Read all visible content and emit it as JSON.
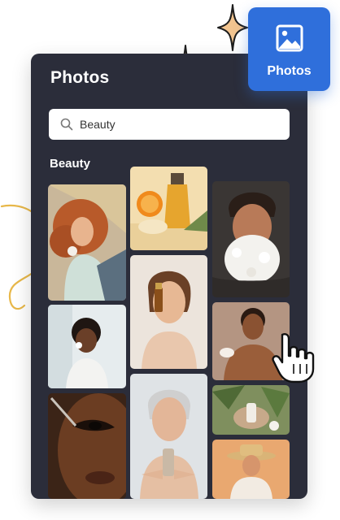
{
  "panel": {
    "title": "Photos"
  },
  "search": {
    "value": "Beauty",
    "icon": "search-icon"
  },
  "section": {
    "label": "Beauty"
  },
  "badge": {
    "label": "Photos",
    "icon": "image-icon"
  },
  "colors": {
    "panel": "#2b2d3a",
    "badge": "#2f6fdb",
    "sparkle": "#f2c48f",
    "doodle": "#e8b84a"
  },
  "photos": [
    {
      "id": "woman-curly-red-hair-flowers"
    },
    {
      "id": "woman-applying-cream-smiling"
    },
    {
      "id": "eye-closeup-dropper"
    },
    {
      "id": "oil-bottles-orange"
    },
    {
      "id": "woman-holding-serum-bottle"
    },
    {
      "id": "older-woman-holding-bottle"
    },
    {
      "id": "man-flower-beard"
    },
    {
      "id": "man-applying-cream"
    },
    {
      "id": "skincare-flatlay-leaves"
    },
    {
      "id": "person-straw-hat"
    }
  ]
}
